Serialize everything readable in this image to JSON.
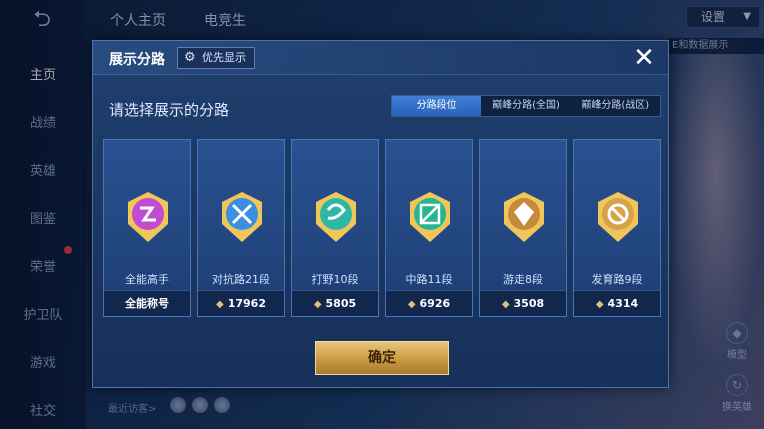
{
  "background": {
    "sidebar": {
      "items": [
        {
          "label": "主页",
          "active": true
        },
        {
          "label": "战绩"
        },
        {
          "label": "英雄"
        },
        {
          "label": "图鉴"
        },
        {
          "label": "荣誉"
        },
        {
          "label": "护卫队"
        },
        {
          "label": "游戏"
        },
        {
          "label": "社交"
        }
      ]
    },
    "top_tabs": [
      "个人主页",
      "电竞生"
    ],
    "settings_label": "设置",
    "notice_text": "E和数据展示",
    "visitor_label": "最近访客>",
    "bottom_right": [
      "模型",
      "换英雄"
    ]
  },
  "modal": {
    "title": "展示分路",
    "priority_label": "优先显示",
    "close_icon": "close-icon",
    "subtitle": "请选择展示的分路",
    "tabs": [
      {
        "label": "分路段位",
        "active": true
      },
      {
        "label": "巅峰分路(全国)"
      },
      {
        "label": "巅峰分路(战区)"
      }
    ],
    "cards": [
      {
        "label": "全能高手",
        "foot": "全能称号",
        "icon": "all-round-badge-icon",
        "color": "#c04ad0",
        "has_value": false
      },
      {
        "label": "对抗路21段",
        "foot": "17962",
        "icon": "clash-lane-badge-icon",
        "color": "#3a8fe0",
        "has_value": true
      },
      {
        "label": "打野10段",
        "foot": "5805",
        "icon": "jungle-badge-icon",
        "color": "#2fb7a6",
        "has_value": true
      },
      {
        "label": "中路11段",
        "foot": "6926",
        "icon": "mid-lane-badge-icon",
        "color": "#26b58e",
        "has_value": true
      },
      {
        "label": "游走8段",
        "foot": "3508",
        "icon": "roam-badge-icon",
        "color": "#c58a3a",
        "has_value": true
      },
      {
        "label": "发育路9段",
        "foot": "4314",
        "icon": "farm-lane-badge-icon",
        "color": "#d6a24a",
        "has_value": true
      }
    ],
    "confirm_label": "确定"
  }
}
